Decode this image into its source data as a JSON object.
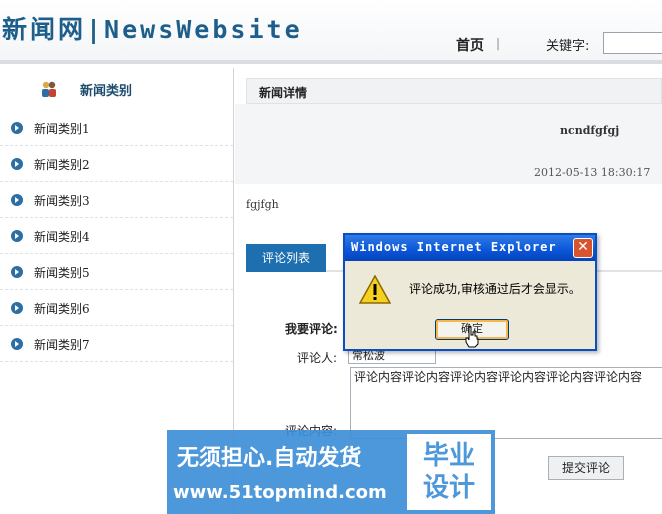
{
  "header": {
    "logo_text": "新闻网|NewsWebsite",
    "nav_home": "首页",
    "nav_separator": "|",
    "keyword_label": "关键字:",
    "keyword_value": ""
  },
  "sidebar": {
    "title": "新闻类别",
    "items": [
      {
        "label": "新闻类别1"
      },
      {
        "label": "新闻类别2"
      },
      {
        "label": "新闻类别3"
      },
      {
        "label": "新闻类别4"
      },
      {
        "label": "新闻类别5"
      },
      {
        "label": "新闻类别6"
      },
      {
        "label": "新闻类别7"
      }
    ]
  },
  "main": {
    "section_title": "新闻详情",
    "news_title": "ncndfgfgj",
    "news_date": "2012-05-13 18:30:17",
    "news_body": "fgjfgh",
    "tab_label": "评论列表",
    "my_comment_label": "我要评论:",
    "commenter_label": "评论人:",
    "commenter_value": "常松波",
    "content_label": "评论内容:",
    "content_value": "评论内容评论内容评论内容评论内容评论内容评论内容",
    "submit_label": "提交评论"
  },
  "dialog": {
    "title": "Windows Internet Explorer",
    "close_glyph": "✕",
    "message": "评论成功,审核通过后才会显示。",
    "ok_label": "确定"
  },
  "watermark": {
    "slogan": "无须担心.自动发货",
    "url": "www.51topmind.com",
    "box_line1": "毕业",
    "box_line2": "设计"
  },
  "colors": {
    "accent": "#1e6fb0",
    "dialog_titlebar": "#0a55d8",
    "watermark": "#3e8fd8"
  }
}
